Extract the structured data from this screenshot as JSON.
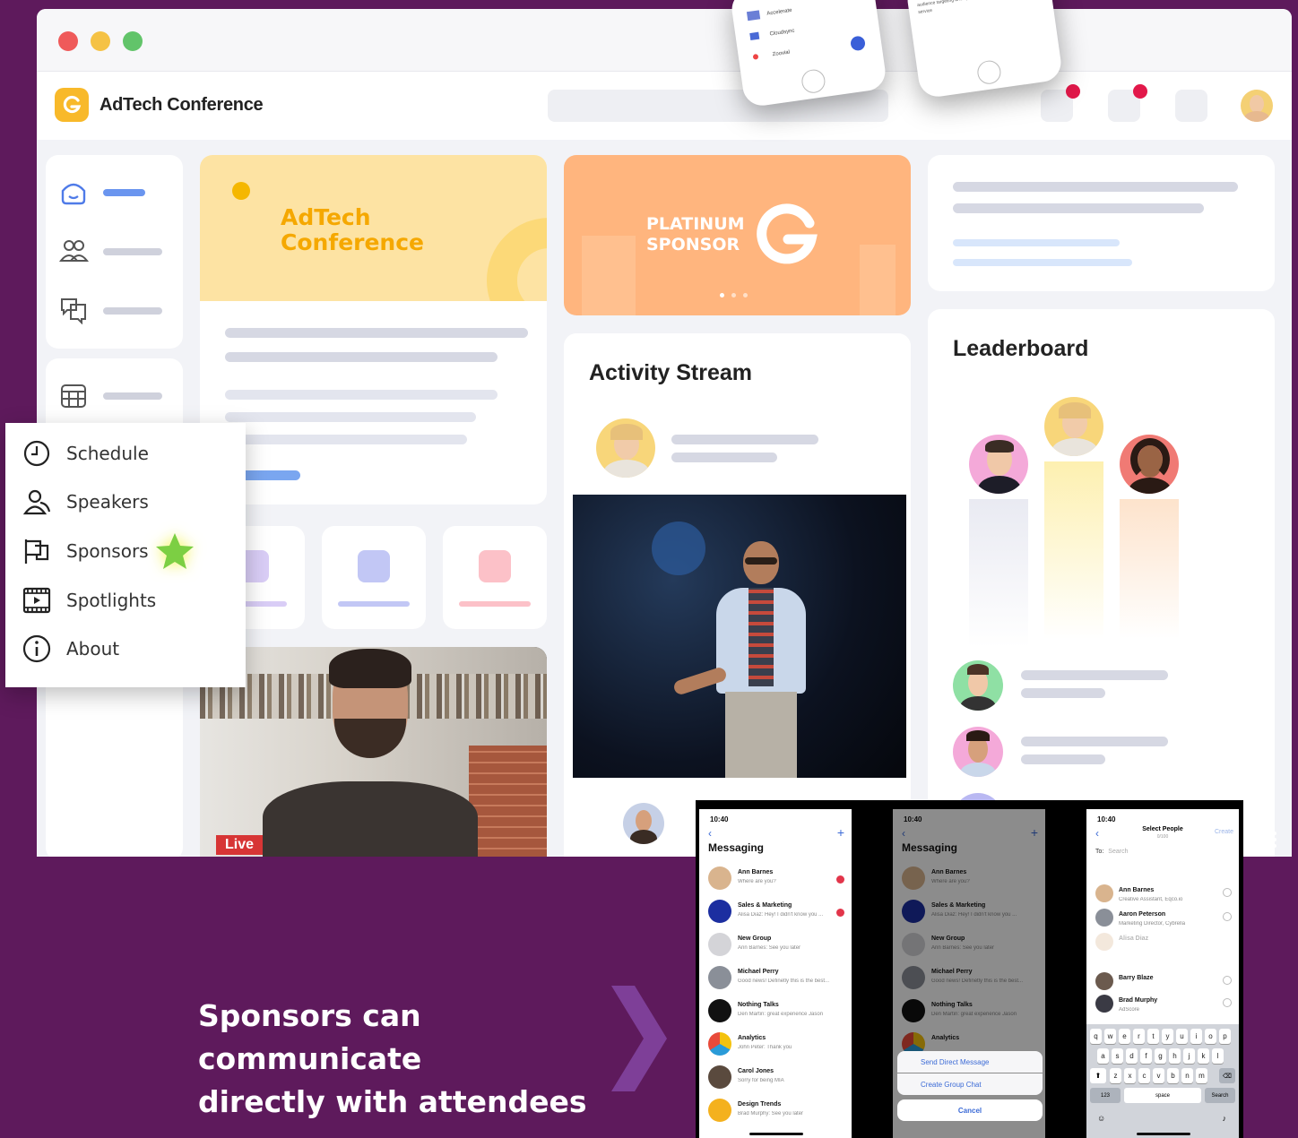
{
  "window": {
    "title": "AdTech Conference",
    "traffic_lights": [
      "#ef5a5a",
      "#f5c245",
      "#62c46a"
    ]
  },
  "hero_card": {
    "title_line1": "AdTech",
    "title_line2": "Conference"
  },
  "sponsor_banner": {
    "line1": "PLATINUM",
    "line2": "SPONSOR"
  },
  "activity_stream": {
    "title": "Activity Stream"
  },
  "leaderboard": {
    "title": "Leaderboard"
  },
  "video": {
    "live_label": "Live"
  },
  "side_menu": {
    "items": [
      {
        "label": "Schedule",
        "icon": "clock-icon"
      },
      {
        "label": "Speakers",
        "icon": "users-icon"
      },
      {
        "label": "Sponsors",
        "icon": "flag-icon"
      },
      {
        "label": "Spotlights",
        "icon": "film-icon"
      },
      {
        "label": "About",
        "icon": "info-icon"
      }
    ],
    "highlighted": "Sponsors"
  },
  "promo": {
    "line1": "Sponsors can communicate",
    "line2": "directly with attendees"
  },
  "phone1": {
    "time": "10:40",
    "title": "Messaging",
    "messages": [
      {
        "name": "Ann Barnes",
        "preview": "Where are you?"
      },
      {
        "name": "Sales & Marketing",
        "preview": "Alisa Diaz: Hey! I didn't know you ..."
      },
      {
        "name": "New Group",
        "preview": "Ann Barnes: See you later"
      },
      {
        "name": "Michael Perry",
        "preview": "Good news! Definetly this is the best..."
      },
      {
        "name": "Nothing Talks",
        "preview": "Den Martin: great experience Jason"
      },
      {
        "name": "Analytics",
        "preview": "John Peter: Thank you"
      },
      {
        "name": "Carol Jones",
        "preview": "Sorry for being MIA"
      },
      {
        "name": "Design Trends",
        "preview": "Brad Murphy: See you later"
      }
    ]
  },
  "phone2": {
    "time": "10:40",
    "title": "Messaging",
    "messages": [
      {
        "name": "Ann Barnes",
        "preview": "Where are you?"
      },
      {
        "name": "Sales & Marketing",
        "preview": "Alisa Diaz: Hey! I didn't know you ..."
      },
      {
        "name": "New Group",
        "preview": "Ann Barnes: See you later"
      },
      {
        "name": "Michael Perry",
        "preview": "Good news! Definetly this is the best..."
      },
      {
        "name": "Nothing Talks",
        "preview": "Den Martin: great experience Jason"
      },
      {
        "name": "Analytics",
        "preview": ""
      }
    ],
    "sheet": {
      "send_dm": "Send Direct Message",
      "create_group": "Create Group Chat",
      "cancel": "Cancel"
    }
  },
  "phone3": {
    "time": "10:40",
    "title": "Select People",
    "subtitle": "0/100",
    "create": "Create",
    "to_label": "To:",
    "search_placeholder": "Search",
    "people": [
      {
        "name": "Ann Barnes",
        "role": "Creative Assistant, Eqco.io"
      },
      {
        "name": "Aaron Peterson",
        "role": "Marketing Director, Cybrella"
      },
      {
        "name": "Alisa Diaz",
        "role": ""
      },
      {
        "name": "Barry Blaze",
        "role": ""
      },
      {
        "name": "Brad Murphy",
        "role": "AdScore"
      }
    ],
    "keyboard": {
      "row1": [
        "q",
        "w",
        "e",
        "r",
        "t",
        "y",
        "u",
        "i",
        "o",
        "p"
      ],
      "row2": [
        "a",
        "s",
        "d",
        "f",
        "g",
        "h",
        "j",
        "k",
        "l"
      ],
      "row3": [
        "z",
        "x",
        "c",
        "v",
        "b",
        "n",
        "m"
      ],
      "num": "123",
      "space": "space",
      "search": "Search"
    }
  },
  "phones_top": {
    "left_items": [
      "Accelerate",
      "Cloudsync",
      "Zoovial"
    ],
    "right_text": "We create engaging, shareable, social content. Then we use our proprietary tech to optimize advertising creatives, audience targeting and spend. This end-to-end managed service"
  }
}
